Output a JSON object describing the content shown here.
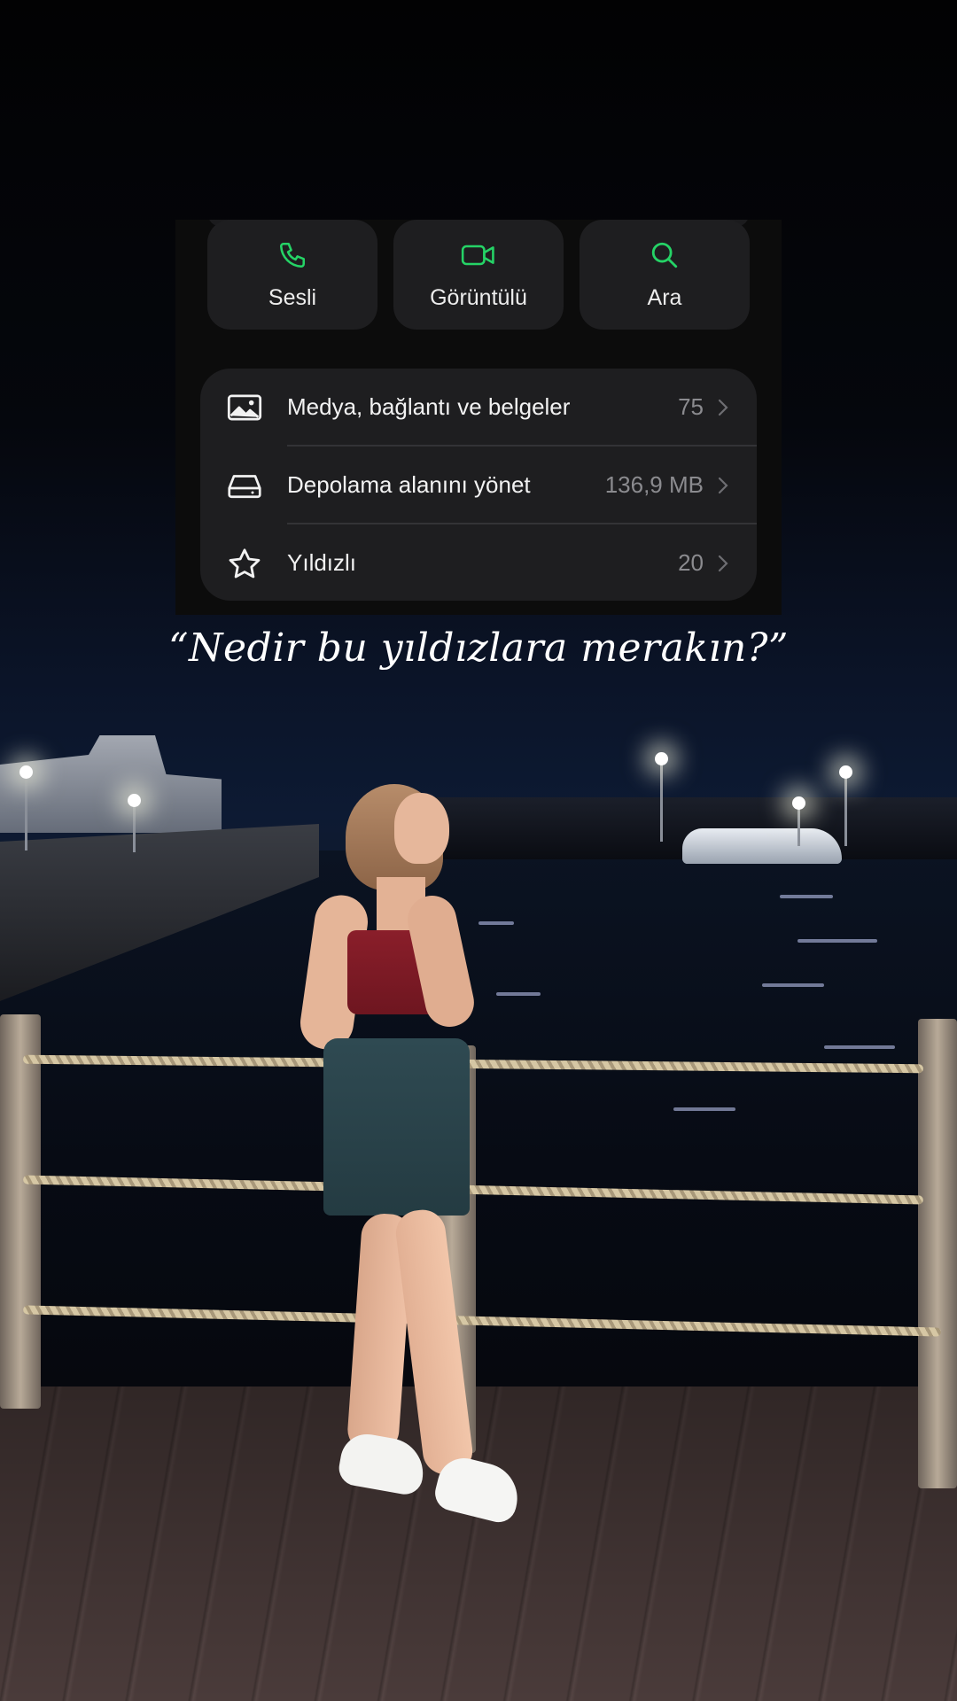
{
  "actions": [
    {
      "label": "Sesli",
      "icon": "phone-icon"
    },
    {
      "label": "Görüntülü",
      "icon": "video-icon"
    },
    {
      "label": "Ara",
      "icon": "search-icon"
    }
  ],
  "media_section": {
    "rows": [
      {
        "label": "Medya, bağlantı ve belgeler",
        "value": "75",
        "icon": "image-icon"
      },
      {
        "label": "Depolama alanını yönet",
        "value": "136,9 MB",
        "icon": "storage-icon"
      },
      {
        "label": "Yıldızlı",
        "value": "20",
        "icon": "star-icon"
      }
    ]
  },
  "caption": "“Nedir bu yıldızlara merakın?”",
  "colors": {
    "accent_green": "#25d366",
    "card_bg": "#1e1e20",
    "secondary_text": "#8b8b8f"
  }
}
